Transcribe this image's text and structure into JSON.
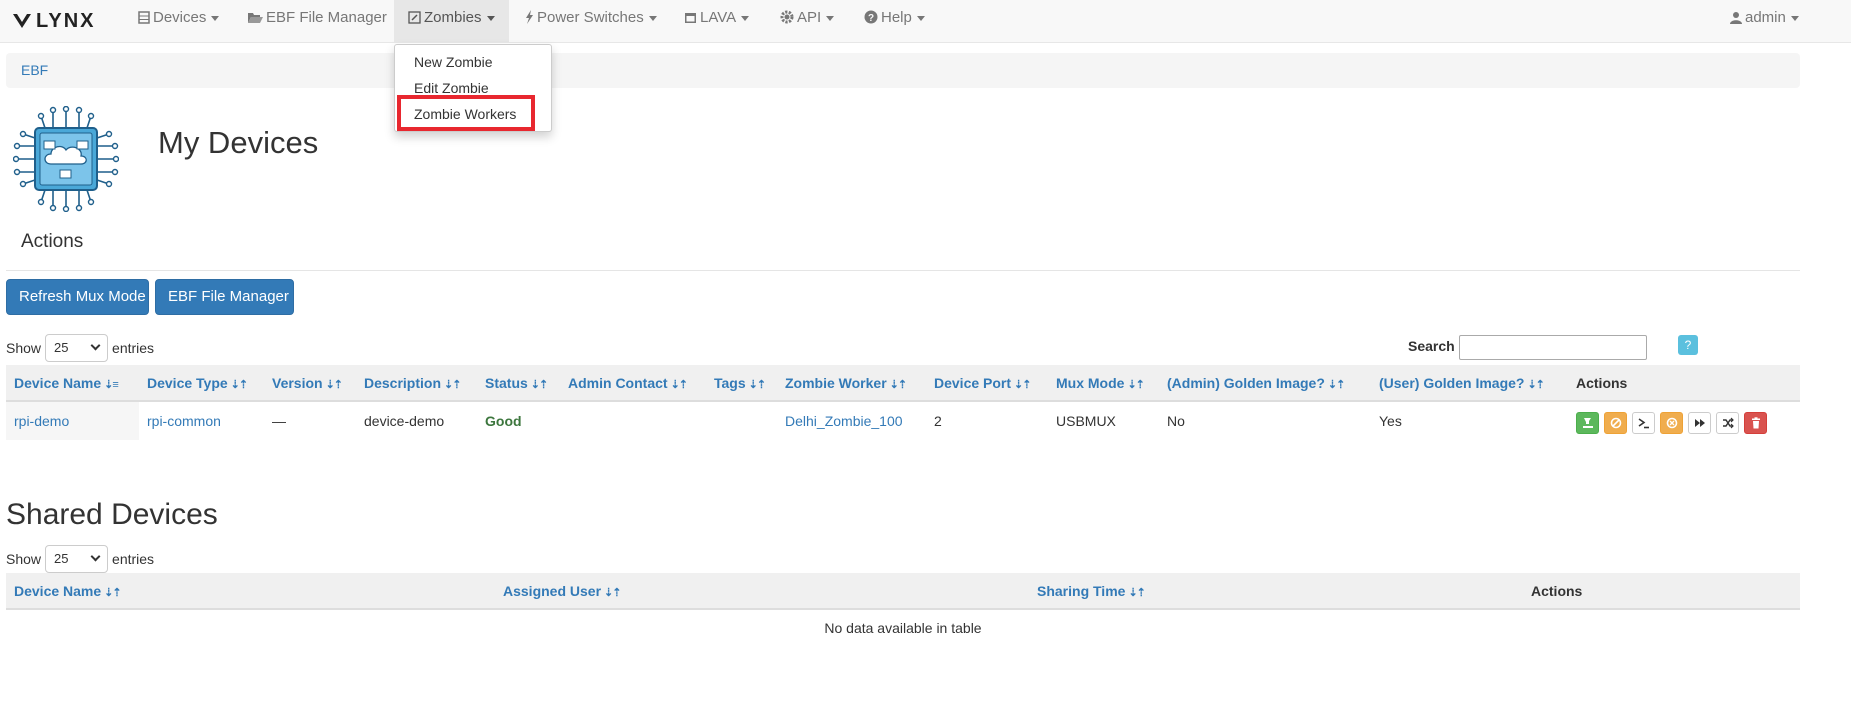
{
  "navbar": {
    "brand": "LYNX",
    "items": [
      {
        "label": "Devices",
        "icon": "server-icon"
      },
      {
        "label": "EBF File Manager",
        "icon": "folder-open-icon"
      },
      {
        "label": "Zombies",
        "icon": "edit-icon"
      },
      {
        "label": "Power Switches",
        "icon": "flash-icon"
      },
      {
        "label": "LAVA",
        "icon": "calendar-icon"
      },
      {
        "label": "API",
        "icon": "cog-icon"
      },
      {
        "label": "Help",
        "icon": "question-circle-icon"
      }
    ],
    "user": {
      "label": "admin",
      "icon": "user-icon"
    }
  },
  "zombies_menu": {
    "items": [
      "New Zombie",
      "Edit Zombie",
      "Zombie Workers"
    ],
    "highlighted": "Zombie Workers",
    "highlight_color": "#e8272f"
  },
  "breadcrumb": {
    "item": "EBF"
  },
  "page": {
    "title": "My Devices",
    "actions_heading": "Actions",
    "buttons": {
      "refresh": "Refresh Mux Mode",
      "file_manager": "EBF File Manager"
    }
  },
  "my_devices_table": {
    "show_label": "Show",
    "entries_label": "entries",
    "page_size": "25",
    "search_label": "Search",
    "search_value": "",
    "help_label": "?",
    "sort_glyph_asc": "⇣≡",
    "sort_glyph": "⇣⇡",
    "columns": [
      "Device Name",
      "Device Type",
      "Version",
      "Description",
      "Status",
      "Admin Contact",
      "Tags",
      "Zombie Worker",
      "Device Port",
      "Mux Mode",
      "(Admin) Golden Image?",
      "(User) Golden Image?",
      "Actions"
    ],
    "rows": [
      {
        "device_name": "rpi-demo",
        "device_type": "rpi-common",
        "version": "—",
        "description": "device-demo",
        "status": "Good",
        "admin_contact": "",
        "tags": "",
        "zombie_worker": "Delhi_Zombie_100",
        "device_port": "2",
        "mux_mode": "USBMUX",
        "admin_golden": "No",
        "user_golden": "Yes",
        "actions": [
          {
            "icon": "download-icon",
            "color": "#5cb85c"
          },
          {
            "icon": "ban-icon",
            "color": "#f0ad4e"
          },
          {
            "icon": "terminal-icon",
            "color": "#ffffff"
          },
          {
            "icon": "stop-circle-icon",
            "color": "#f0ad4e"
          },
          {
            "icon": "fast-forward-icon",
            "color": "#ffffff"
          },
          {
            "icon": "random-icon",
            "color": "#ffffff"
          },
          {
            "icon": "trash-icon",
            "color": "#d9534f"
          }
        ]
      }
    ]
  },
  "shared_devices": {
    "title": "Shared Devices",
    "show_label": "Show",
    "entries_label": "entries",
    "page_size": "25",
    "columns": [
      "Device Name",
      "Assigned User",
      "Sharing Time",
      "Actions"
    ],
    "empty_text": "No data available in table"
  }
}
